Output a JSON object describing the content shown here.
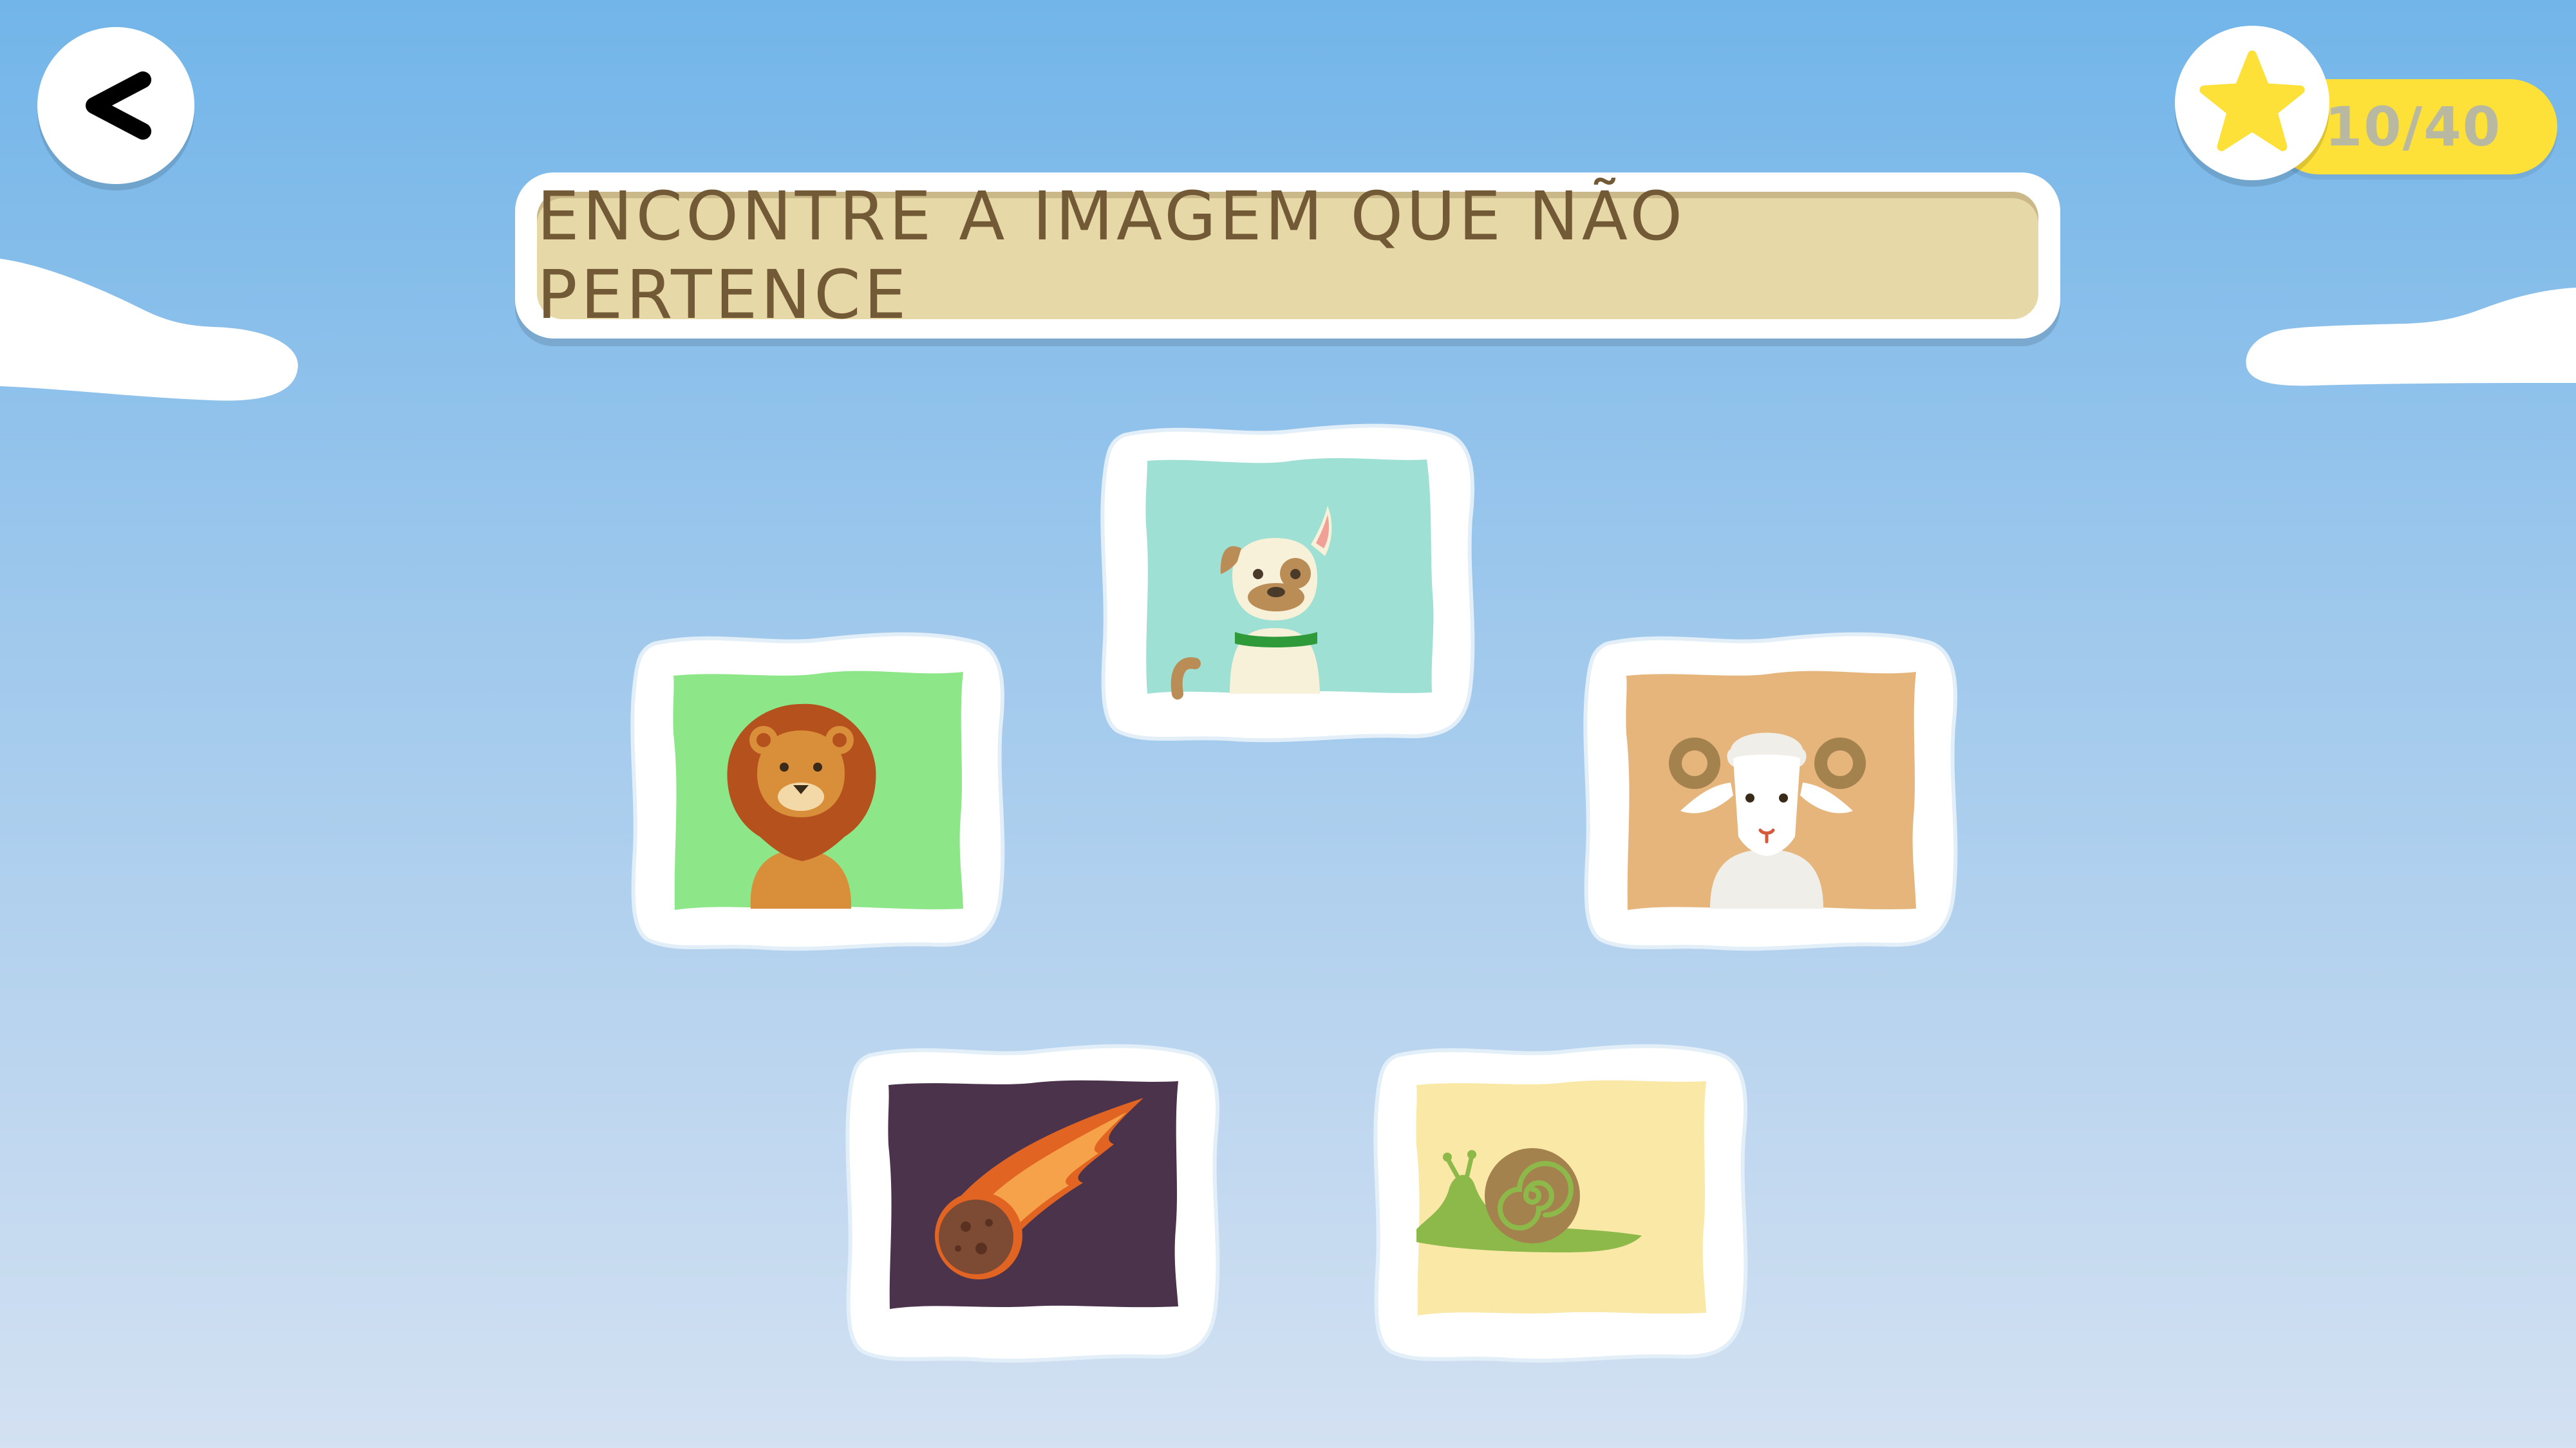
{
  "header": {
    "back_icon": "chevron-left-icon",
    "instruction": "ENCONTRE A IMAGEM QUE NÃO PERTENCE"
  },
  "score": {
    "icon": "star-icon",
    "text": "10/40",
    "current": 10,
    "total": 40
  },
  "cards": [
    {
      "id": "dog",
      "icon": "dog-icon",
      "bg": "#9ee0d4"
    },
    {
      "id": "lion",
      "icon": "lion-icon",
      "bg": "#8de789"
    },
    {
      "id": "sheep",
      "icon": "sheep-icon",
      "bg": "#e5b57c"
    },
    {
      "id": "meteor",
      "icon": "meteor-icon",
      "bg": "#4a334b"
    },
    {
      "id": "snail",
      "icon": "snail-icon",
      "bg": "#f9e8a6"
    }
  ],
  "colors": {
    "banner_bg": "#e7d8a8",
    "banner_text": "#735a37",
    "score_pill": "#fde038",
    "star": "#fde038"
  }
}
